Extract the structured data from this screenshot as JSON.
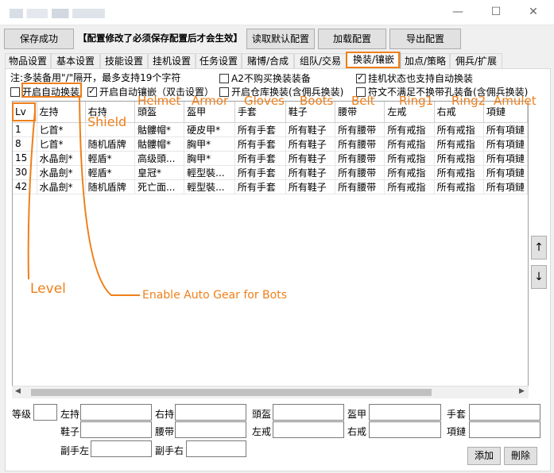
{
  "window": {
    "minimize": "—",
    "maximize": "☐",
    "close": "✕"
  },
  "toolbar": {
    "save_label": "保存成功",
    "notice": "【配置修改了必须保存配置后才会生效】",
    "read_default_label": "读取默认配置",
    "load_label": "加载配置",
    "export_label": "导出配置"
  },
  "tabs": [
    "物品设置",
    "基本设置",
    "技能设置",
    "挂机设置",
    "任务设置",
    "赌博/合成",
    "组队/交易",
    "换装/镶嵌",
    "加点/策略",
    "佣兵/扩展"
  ],
  "options": {
    "note": "注:多装备用\"/\"隔开，最多支持19个字符",
    "a2_no_buy": "A2不购买换装装备",
    "hangup_auto_swap": "挂机状态也支持自动换装",
    "auto_swap": "开启自动换装",
    "auto_socket": "开启自动镶嵌（双击设置）",
    "warehouse_swap": "开启仓库换装(含佣兵换装)",
    "rune_swap": "符文不满足不换带孔装备(含佣兵换装)"
  },
  "table": {
    "headers": [
      "Lv",
      "左持",
      "右持",
      "頭盔",
      "盔甲",
      "手套",
      "鞋子",
      "腰带",
      "左戒",
      "右戒",
      "項鏈"
    ],
    "rows": [
      [
        "1",
        "匕首*",
        "",
        "骷髏帽*",
        "硬皮甲*",
        "所有手套",
        "所有鞋子",
        "所有腰带",
        "所有戒指",
        "所有戒指",
        "所有項鏈"
      ],
      [
        "8",
        "匕首*",
        "随机盾牌",
        "骷髏帽*",
        "胸甲*",
        "所有手套",
        "所有鞋子",
        "所有腰带",
        "所有戒指",
        "所有戒指",
        "所有項鏈"
      ],
      [
        "15",
        "水晶劍*",
        "輕盾*",
        "高级頭...",
        "胸甲*",
        "所有手套",
        "所有鞋子",
        "所有腰带",
        "所有戒指",
        "所有戒指",
        "所有項鏈"
      ],
      [
        "30",
        "水晶劍*",
        "輕盾*",
        "皇冠*",
        "輕型裝...",
        "所有手套",
        "所有鞋子",
        "所有腰带",
        "所有戒指",
        "所有戒指",
        "所有項鏈"
      ],
      [
        "42",
        "水晶劍*",
        "随机盾牌",
        "死亡面...",
        "輕型裝...",
        "所有手套",
        "所有鞋子",
        "所有腰带",
        "所有戒指",
        "所有戒指",
        "所有項鏈"
      ]
    ]
  },
  "side": {
    "up": "↑",
    "down": "↓"
  },
  "form": {
    "level": "等级",
    "left_hand": "左持",
    "right_hand": "右持",
    "helmet": "頭盔",
    "armor": "盔甲",
    "gloves": "手套",
    "boots": "鞋子",
    "belt": "腰带",
    "left_ring": "左戒",
    "right_ring": "右戒",
    "amulet": "項鏈",
    "merc_left": "副手左",
    "merc_right": "副手右",
    "add_label": "添加",
    "delete_label": "刪除"
  },
  "annotations": {
    "helmet": "Helmet",
    "armor": "Armor",
    "gloves": "Gloves",
    "boots": "Boots",
    "belt": "Belt",
    "ring1": "Ring1",
    "ring2": "Ring2",
    "amulet": "Amulet",
    "shield": "Shield",
    "level": "Level",
    "auto_gear": "Enable Auto Gear for Bots"
  },
  "colors": {
    "annotation": "#ef7f1a",
    "active_tab_border": "#ef7f1a"
  }
}
